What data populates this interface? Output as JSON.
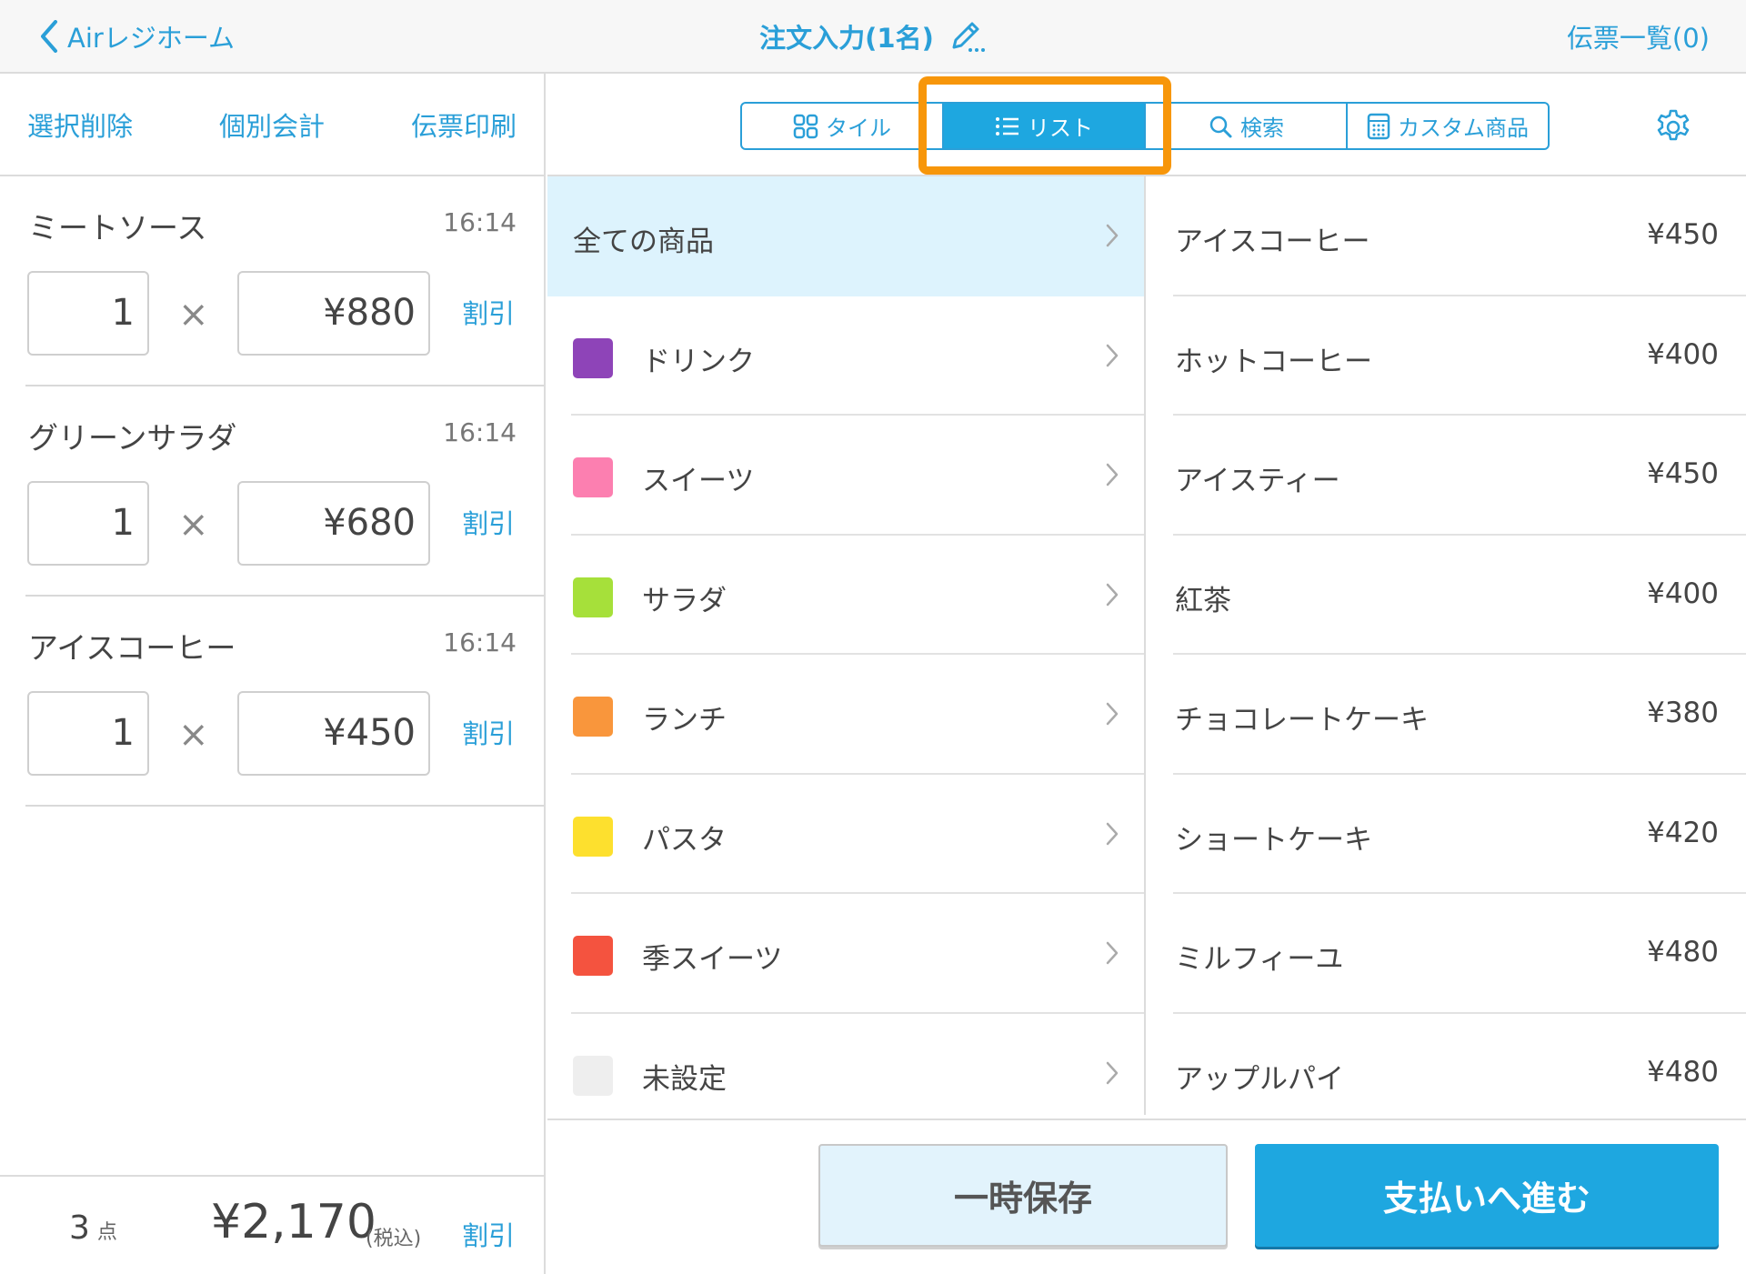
{
  "topbar": {
    "back_label": "Airレジホーム",
    "title": "注文入力(1名)",
    "slip_list": "伝票一覧(0)"
  },
  "left_actions": {
    "delete_selected": "選択削除",
    "split_bill": "個別会計",
    "print_slip": "伝票印刷"
  },
  "order_items": [
    {
      "name": "ミートソース",
      "time": "16:14",
      "qty": "1",
      "price": "¥880",
      "discount": "割引"
    },
    {
      "name": "グリーンサラダ",
      "time": "16:14",
      "qty": "1",
      "price": "¥680",
      "discount": "割引"
    },
    {
      "name": "アイスコーヒー",
      "time": "16:14",
      "qty": "1",
      "price": "¥450",
      "discount": "割引"
    }
  ],
  "times_sign": "×",
  "footer": {
    "count": "3",
    "count_unit": "点",
    "total": "¥2,170",
    "tax_note": "(税込)",
    "discount": "割引"
  },
  "view_tabs": {
    "tile": "タイル",
    "list": "リスト",
    "search": "検索",
    "custom": "カスタム商品",
    "active": "list"
  },
  "categories": [
    {
      "label": "全ての商品",
      "color": ""
    },
    {
      "label": "ドリンク",
      "color": "#8e44b8"
    },
    {
      "label": "スイーツ",
      "color": "#fc7fb0"
    },
    {
      "label": "サラダ",
      "color": "#a6e03a"
    },
    {
      "label": "ランチ",
      "color": "#f9963c"
    },
    {
      "label": "パスタ",
      "color": "#fde02e"
    },
    {
      "label": "季スイーツ",
      "color": "#f4533f"
    },
    {
      "label": "未設定",
      "color": "#eeeeee"
    }
  ],
  "products": [
    {
      "name": "アイスコーヒー",
      "price": "¥450"
    },
    {
      "name": "ホットコーヒー",
      "price": "¥400"
    },
    {
      "name": "アイスティー",
      "price": "¥450"
    },
    {
      "name": "紅茶",
      "price": "¥400"
    },
    {
      "name": "チョコレートケーキ",
      "price": "¥380"
    },
    {
      "name": "ショートケーキ",
      "price": "¥420"
    },
    {
      "name": "ミルフィーユ",
      "price": "¥480"
    },
    {
      "name": "アップルパイ",
      "price": "¥480"
    }
  ],
  "buttons": {
    "save": "一時保存",
    "pay": "支払いへ進む"
  },
  "colors": {
    "accent": "#2a9fd8",
    "active_tab": "#1ea7e0",
    "highlight": "#f7960a",
    "selected_category_bg": "#ddf3fd"
  }
}
